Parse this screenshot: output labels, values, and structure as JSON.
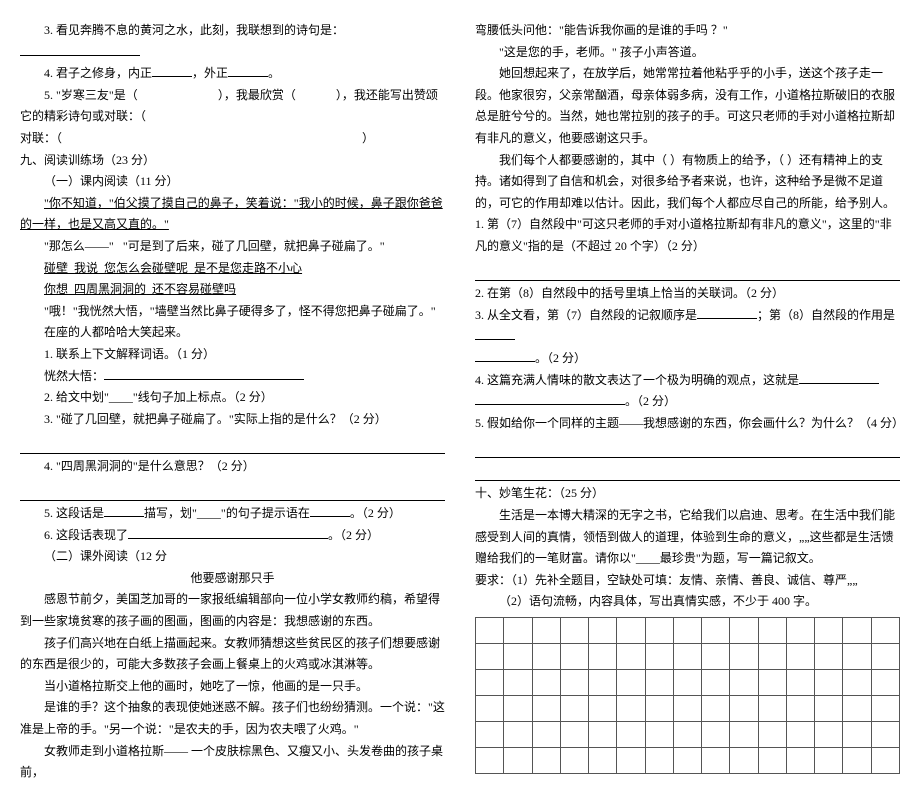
{
  "left": {
    "q3": "3. 看见奔腾不息的黄河之水，此刻，我联想到的诗句是：",
    "q4_a": "4. 君子之修身，内正",
    "q4_b": "，外正",
    "q4_c": "。",
    "q5_a": "5. \"岁寒三友\"是（",
    "q5_b": "），我最欣赏（",
    "q5_c": "），我还能写出赞颂它的精彩诗句或对联：（",
    "q5_d": "）",
    "s9": "九、阅读训练场（23 分）",
    "s9_1": "（一）课内阅读（11 分）",
    "p1_a": "\"你不知道，\"伯父摸了摸自己的鼻子，笑着说：\"我小的时候，鼻子跟你爸爸的一样，也是又高又直的。\"",
    "p2": "\"那怎么——\"",
    "p2b": "\"可是到了后来，碰了几回壁，就把鼻子碰扁了。\"",
    "p3_a": "碰壁",
    "p3_b": "我说",
    "p3_c": "您怎么会碰壁呢",
    "p3_d": "是不是您走路不小心",
    "p4_a": "你想",
    "p4_b": "四周黑洞洞的",
    "p4_c": "还不容易碰壁吗",
    "p5": "\"哦！\"我恍然大悟，\"墙壁当然比鼻子硬得多了，怪不得您把鼻子碰扁了。\"",
    "p6": "在座的人都哈哈大笑起来。",
    "q1": "1. 联系上下文解释词语。（1 分）",
    "q1_a": "恍然大悟：",
    "q2": "2. 给文中划\"____\"线句子加上标点。（2 分）",
    "q3b": "3. \"碰了几回壁，就把鼻子碰扁了。\"实际上指的是什么？（2 分）",
    "q4b": "4. \"四周黑洞洞的\"是什么意思？（2 分）",
    "q5b_a": "5. 这段话是",
    "q5b_b": "描写，划\"____\"的句子提示语在",
    "q5b_c": "。（2 分）",
    "q6_a": "6. 这段话表现了",
    "q6_b": "。（2 分）",
    "s9_2": "（二）课外阅读（12 分",
    "title2": "他要感谢那只手",
    "e1": "感恩节前夕，美国芝加哥的一家报纸编辑部向一位小学女教师约稿，希望得到一些家境贫寒的孩子画的图画，图画的内容是：我想感谢的东西。",
    "e2": "孩子们高兴地在白纸上描画起来。女教师猜想这些贫民区的孩子们想要感谢的东西是很少的，可能大多数孩子会画上餐桌上的火鸡或冰淇淋等。",
    "e3": "当小道格拉斯交上他的画时，她吃了一惊，他画的是一只手。",
    "e4": "是谁的手？这个抽象的表现使她迷惑不解。孩子们也纷纷猜测。一个说：\"这准是上帝的手。\"另一个说：\"是农夫的手，因为农夫喂了火鸡。\"",
    "e5": "女教师走到小道格拉斯—— 一个皮肤棕黑色、又瘦又小、头发卷曲的孩子桌前，"
  },
  "right": {
    "e6": "弯腰低头问他：\"能告诉我你画的是谁的手吗 ？\"",
    "e7": "\"这是您的手，老师。\" 孩子小声答道。",
    "e8": "她回想起来了，在放学后，她常常拉着他粘乎乎的小手，送这个孩子走一段。他家很穷，父亲常酗酒，母亲体弱多病，没有工作，小道格拉斯破旧的衣服总是脏兮兮的。当然，她也常拉别的孩子的手。可这只老师的手对小道格拉斯却有非凡的意义，他要感谢这只手。",
    "e9": "我们每个人都要感谢的，其中（  ）有物质上的给予，（  ）还有精神上的支持。诸如得到了自信和机会，对很多给予者来说，也许，这种给予是微不足道的，可它的作用却难以估计。因此，我们每个人都应尽自己的所能，给予别人。",
    "rq1": "1. 第（7）自然段中\"可这只老师的手对小道格拉斯却有非凡的意义\"，这里的\"非凡的意义\"指的是（不超过 20 个字）（2 分）",
    "rq2": "2. 在第（8）自然段中的括号里填上恰当的关联词。（2 分）",
    "rq3_a": "3. 从全文看，第（7）自然段的记叙顺序是",
    "rq3_b": "；第（8）自然段的作用是",
    "rq3_c": "。（2 分）",
    "rq4_a": "4. 这篇充满人情味的散文表达了一个极为明确的观点，这就是",
    "rq4_b": "。（2 分）",
    "rq5": "5. 假如给你一个同样的主题——我想感谢的东西，你会画什么？为什么？（4 分）",
    "s10": "十、妙笔生花：（25 分）",
    "c1": "生活是一本博大精深的无字之书，它给我们以启迪、思考。在生活中我们能感受到人间的真情，领悟到做人的道理，体验到生命的意义，„„这些都是生活馈赠给我们的一笔财富。请你以\"____最珍贵\"为题，写一篇记叙文。",
    "c2": "要求：（1）先补全题目，空缺处可填：友情、亲情、善良、诚信、尊严„„",
    "c3": "（2）语句流畅，内容具体，写出真情实感，不少于 400 字。"
  }
}
